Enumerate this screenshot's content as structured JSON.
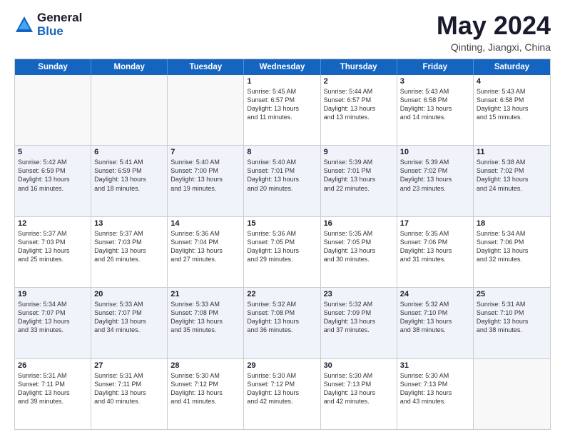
{
  "logo": {
    "general": "General",
    "blue": "Blue"
  },
  "header": {
    "month": "May 2024",
    "location": "Qinting, Jiangxi, China"
  },
  "weekdays": [
    "Sunday",
    "Monday",
    "Tuesday",
    "Wednesday",
    "Thursday",
    "Friday",
    "Saturday"
  ],
  "rows": [
    [
      {
        "day": "",
        "lines": [],
        "empty": true
      },
      {
        "day": "",
        "lines": [],
        "empty": true
      },
      {
        "day": "",
        "lines": [],
        "empty": true
      },
      {
        "day": "1",
        "lines": [
          "Sunrise: 5:45 AM",
          "Sunset: 6:57 PM",
          "Daylight: 13 hours",
          "and 11 minutes."
        ]
      },
      {
        "day": "2",
        "lines": [
          "Sunrise: 5:44 AM",
          "Sunset: 6:57 PM",
          "Daylight: 13 hours",
          "and 13 minutes."
        ]
      },
      {
        "day": "3",
        "lines": [
          "Sunrise: 5:43 AM",
          "Sunset: 6:58 PM",
          "Daylight: 13 hours",
          "and 14 minutes."
        ]
      },
      {
        "day": "4",
        "lines": [
          "Sunrise: 5:43 AM",
          "Sunset: 6:58 PM",
          "Daylight: 13 hours",
          "and 15 minutes."
        ]
      }
    ],
    [
      {
        "day": "5",
        "lines": [
          "Sunrise: 5:42 AM",
          "Sunset: 6:59 PM",
          "Daylight: 13 hours",
          "and 16 minutes."
        ]
      },
      {
        "day": "6",
        "lines": [
          "Sunrise: 5:41 AM",
          "Sunset: 6:59 PM",
          "Daylight: 13 hours",
          "and 18 minutes."
        ]
      },
      {
        "day": "7",
        "lines": [
          "Sunrise: 5:40 AM",
          "Sunset: 7:00 PM",
          "Daylight: 13 hours",
          "and 19 minutes."
        ]
      },
      {
        "day": "8",
        "lines": [
          "Sunrise: 5:40 AM",
          "Sunset: 7:01 PM",
          "Daylight: 13 hours",
          "and 20 minutes."
        ]
      },
      {
        "day": "9",
        "lines": [
          "Sunrise: 5:39 AM",
          "Sunset: 7:01 PM",
          "Daylight: 13 hours",
          "and 22 minutes."
        ]
      },
      {
        "day": "10",
        "lines": [
          "Sunrise: 5:39 AM",
          "Sunset: 7:02 PM",
          "Daylight: 13 hours",
          "and 23 minutes."
        ]
      },
      {
        "day": "11",
        "lines": [
          "Sunrise: 5:38 AM",
          "Sunset: 7:02 PM",
          "Daylight: 13 hours",
          "and 24 minutes."
        ]
      }
    ],
    [
      {
        "day": "12",
        "lines": [
          "Sunrise: 5:37 AM",
          "Sunset: 7:03 PM",
          "Daylight: 13 hours",
          "and 25 minutes."
        ]
      },
      {
        "day": "13",
        "lines": [
          "Sunrise: 5:37 AM",
          "Sunset: 7:03 PM",
          "Daylight: 13 hours",
          "and 26 minutes."
        ]
      },
      {
        "day": "14",
        "lines": [
          "Sunrise: 5:36 AM",
          "Sunset: 7:04 PM",
          "Daylight: 13 hours",
          "and 27 minutes."
        ]
      },
      {
        "day": "15",
        "lines": [
          "Sunrise: 5:36 AM",
          "Sunset: 7:05 PM",
          "Daylight: 13 hours",
          "and 29 minutes."
        ]
      },
      {
        "day": "16",
        "lines": [
          "Sunrise: 5:35 AM",
          "Sunset: 7:05 PM",
          "Daylight: 13 hours",
          "and 30 minutes."
        ]
      },
      {
        "day": "17",
        "lines": [
          "Sunrise: 5:35 AM",
          "Sunset: 7:06 PM",
          "Daylight: 13 hours",
          "and 31 minutes."
        ]
      },
      {
        "day": "18",
        "lines": [
          "Sunrise: 5:34 AM",
          "Sunset: 7:06 PM",
          "Daylight: 13 hours",
          "and 32 minutes."
        ]
      }
    ],
    [
      {
        "day": "19",
        "lines": [
          "Sunrise: 5:34 AM",
          "Sunset: 7:07 PM",
          "Daylight: 13 hours",
          "and 33 minutes."
        ]
      },
      {
        "day": "20",
        "lines": [
          "Sunrise: 5:33 AM",
          "Sunset: 7:07 PM",
          "Daylight: 13 hours",
          "and 34 minutes."
        ]
      },
      {
        "day": "21",
        "lines": [
          "Sunrise: 5:33 AM",
          "Sunset: 7:08 PM",
          "Daylight: 13 hours",
          "and 35 minutes."
        ]
      },
      {
        "day": "22",
        "lines": [
          "Sunrise: 5:32 AM",
          "Sunset: 7:08 PM",
          "Daylight: 13 hours",
          "and 36 minutes."
        ]
      },
      {
        "day": "23",
        "lines": [
          "Sunrise: 5:32 AM",
          "Sunset: 7:09 PM",
          "Daylight: 13 hours",
          "and 37 minutes."
        ]
      },
      {
        "day": "24",
        "lines": [
          "Sunrise: 5:32 AM",
          "Sunset: 7:10 PM",
          "Daylight: 13 hours",
          "and 38 minutes."
        ]
      },
      {
        "day": "25",
        "lines": [
          "Sunrise: 5:31 AM",
          "Sunset: 7:10 PM",
          "Daylight: 13 hours",
          "and 38 minutes."
        ]
      }
    ],
    [
      {
        "day": "26",
        "lines": [
          "Sunrise: 5:31 AM",
          "Sunset: 7:11 PM",
          "Daylight: 13 hours",
          "and 39 minutes."
        ]
      },
      {
        "day": "27",
        "lines": [
          "Sunrise: 5:31 AM",
          "Sunset: 7:11 PM",
          "Daylight: 13 hours",
          "and 40 minutes."
        ]
      },
      {
        "day": "28",
        "lines": [
          "Sunrise: 5:30 AM",
          "Sunset: 7:12 PM",
          "Daylight: 13 hours",
          "and 41 minutes."
        ]
      },
      {
        "day": "29",
        "lines": [
          "Sunrise: 5:30 AM",
          "Sunset: 7:12 PM",
          "Daylight: 13 hours",
          "and 42 minutes."
        ]
      },
      {
        "day": "30",
        "lines": [
          "Sunrise: 5:30 AM",
          "Sunset: 7:13 PM",
          "Daylight: 13 hours",
          "and 42 minutes."
        ]
      },
      {
        "day": "31",
        "lines": [
          "Sunrise: 5:30 AM",
          "Sunset: 7:13 PM",
          "Daylight: 13 hours",
          "and 43 minutes."
        ]
      },
      {
        "day": "",
        "lines": [],
        "empty": true
      }
    ]
  ]
}
